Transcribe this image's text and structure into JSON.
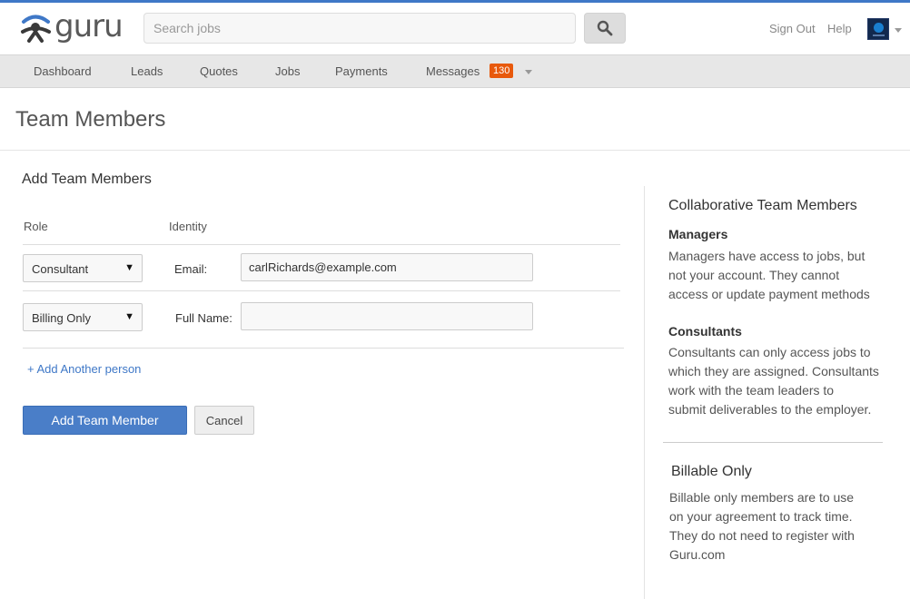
{
  "brand": {
    "name": "guru"
  },
  "search": {
    "placeholder": "Search jobs",
    "value": ""
  },
  "header": {
    "sign_out": "Sign Out",
    "help": "Help"
  },
  "nav": {
    "items": [
      "Dashboard",
      "Leads",
      "Quotes",
      "Jobs",
      "Payments",
      "Messages"
    ],
    "messages_count": "130"
  },
  "page": {
    "title": "Team Members"
  },
  "form": {
    "title": "Add Team Members",
    "role_header": "Role",
    "identity_header": "Identity",
    "rows": [
      {
        "role": "Consultant",
        "label": "Email:",
        "value": "carlRichards@example.com"
      },
      {
        "role": "Billing Only",
        "label": "Full Name:",
        "value": ""
      }
    ],
    "add_link": "+ Add Another person",
    "submit_label": "Add Team Member",
    "cancel_label": "Cancel"
  },
  "sidebar": {
    "title": "Collaborative Team Members",
    "managers_heading": "Managers",
    "managers_text": [
      "Managers have access to jobs, but",
      "not your account. They cannot",
      "access or update payment methods"
    ],
    "consultants_heading": "Consultants",
    "consultants_text": [
      "Consultants can only access jobs to",
      "which they are assigned. Consultants",
      "work with the team leaders to",
      "submit deliverables to the employer."
    ],
    "billable_title": "Billable Only",
    "billable_text": [
      "Billable only members are to use",
      "on your agreement to track time.",
      "They do not need to register with",
      "Guru.com"
    ]
  },
  "colors": {
    "accent": "#3f78c7",
    "badge": "#e8590c",
    "primary_button": "#4a7ec8"
  },
  "icons": [
    "guru-logo-icon",
    "search-icon",
    "caret-down-icon",
    "dropdown-arrow-icon"
  ]
}
